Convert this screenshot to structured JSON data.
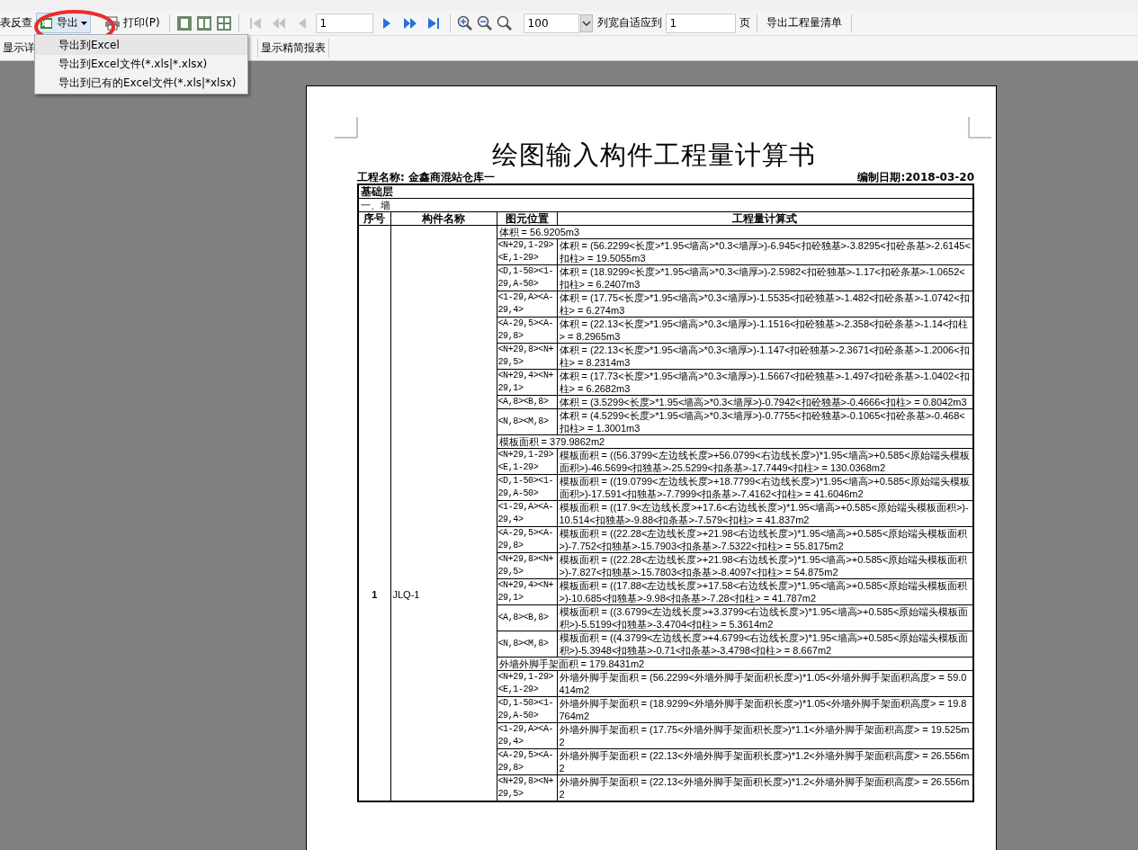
{
  "toolbar": {
    "reverse_lookup": "表反查",
    "export": "导出",
    "print": "打印(P)",
    "nav": [
      {
        "kind": "first",
        "disabled": true
      },
      {
        "kind": "prev",
        "disabled": true
      },
      {
        "kind": "step-back",
        "disabled": true
      }
    ],
    "page": "1",
    "nav_after": [
      {
        "kind": "step-forward",
        "disabled": false
      },
      {
        "kind": "next",
        "disabled": false
      },
      {
        "kind": "last",
        "disabled": false
      }
    ],
    "zoom": "100",
    "fit_label": "列宽自适应到",
    "fit_value": "1",
    "fit_unit": "页",
    "export_list": "导出工程量清单"
  },
  "toolbar2": {
    "detail": "显示详",
    "simple": "显示精简报表"
  },
  "export_menu": [
    {
      "label": "导出到Excel",
      "selected": true
    },
    {
      "label": "导出到Excel文件(*.xls|*.xlsx)",
      "selected": false
    },
    {
      "label": "导出到已有的Excel文件(*.xls|*xlsx)",
      "selected": false
    }
  ],
  "report": {
    "title": "绘图输入构件工程量计算书",
    "project": "工程名称: 金鑫商混站仓库一",
    "date": "编制日期:2018-03-20",
    "floor": "基础层",
    "section": "一、墙",
    "columns": [
      "序号",
      "构件名称",
      "图元位置",
      "工程量计算式"
    ],
    "items": [
      {
        "index": "1",
        "name": "JLQ-1",
        "groups": [
          {
            "summary": "体积 = 56.9205m3",
            "rows": [
              {
                "position": "<N+29,1-29><E,1-29>",
                "formula": "体积 = (56.2299<长度>*1.95<墙高>*0.3<墙厚>)-6.945<扣砼独基>-3.8295<扣砼条基>-2.6145<扣柱> = 19.5055m3"
              },
              {
                "position": "<D,1-50><1-29,A-50>",
                "formula": "体积 = (18.9299<长度>*1.95<墙高>*0.3<墙厚>)-2.5982<扣砼独基>-1.17<扣砼条基>-1.0652<扣柱> = 6.2407m3"
              },
              {
                "position": "<1-29,A><A-29,4>",
                "formula": "体积 = (17.75<长度>*1.95<墙高>*0.3<墙厚>)-1.5535<扣砼独基>-1.482<扣砼条基>-1.0742<扣柱> = 6.274m3"
              },
              {
                "position": "<A-29,5><A-29,8>",
                "formula": "体积 = (22.13<长度>*1.95<墙高>*0.3<墙厚>)-1.1516<扣砼独基>-2.358<扣砼条基>-1.14<扣柱> = 8.2965m3"
              },
              {
                "position": "<N+29,8><N+29,5>",
                "formula": "体积 = (22.13<长度>*1.95<墙高>*0.3<墙厚>)-1.147<扣砼独基>-2.3671<扣砼条基>-1.2006<扣柱> = 8.2314m3"
              },
              {
                "position": "<N+29,4><N+29,1>",
                "formula": "体积 = (17.73<长度>*1.95<墙高>*0.3<墙厚>)-1.5667<扣砼独基>-1.497<扣砼条基>-1.0402<扣柱> = 6.2682m3"
              },
              {
                "position": "<A,8><B,8>",
                "formula": "体积 = (3.5299<长度>*1.95<墙高>*0.3<墙厚>)-0.7942<扣砼独基>-0.4666<扣柱> = 0.8042m3"
              },
              {
                "position": "<N,8><M,8>",
                "formula": "体积 = (4.5299<长度>*1.95<墙高>*0.3<墙厚>)-0.7755<扣砼独基>-0.1065<扣砼条基>-0.468<扣柱> = 1.3001m3"
              }
            ]
          },
          {
            "summary": "模板面积 = 379.9862m2",
            "rows": [
              {
                "position": "<N+29,1-29><E,1-29>",
                "formula": "模板面积 = ((56.3799<左边线长度>+56.0799<右边线长度>)*1.95<墙高>+0.585<原始端头模板面积>)-46.5699<扣独基>-25.5299<扣条基>-17.7449<扣柱> = 130.0368m2"
              },
              {
                "position": "<D,1-50><1-29,A-50>",
                "formula": "模板面积 = ((19.0799<左边线长度>+18.7799<右边线长度>)*1.95<墙高>+0.585<原始端头模板面积>)-17.591<扣独基>-7.7999<扣条基>-7.4162<扣柱> = 41.6046m2"
              },
              {
                "position": "<1-29,A><A-29,4>",
                "formula": "模板面积 = ((17.9<左边线长度>+17.6<右边线长度>)*1.95<墙高>+0.585<原始端头模板面积>)-10.514<扣独基>-9.88<扣条基>-7.579<扣柱> = 41.837m2"
              },
              {
                "position": "<A-29,5><A-29,8>",
                "formula": "模板面积 = ((22.28<左边线长度>+21.98<右边线长度>)*1.95<墙高>+0.585<原始端头模板面积>)-7.752<扣独基>-15.7903<扣条基>-7.5322<扣柱> = 55.8175m2"
              },
              {
                "position": "<N+29,8><N+29,5>",
                "formula": "模板面积 = ((22.28<左边线长度>+21.98<右边线长度>)*1.95<墙高>+0.585<原始端头模板面积>)-7.827<扣独基>-15.7803<扣条基>-8.4097<扣柱> = 54.875m2"
              },
              {
                "position": "<N+29,4><N+29,1>",
                "formula": "模板面积 = ((17.88<左边线长度>+17.58<右边线长度>)*1.95<墙高>+0.585<原始端头模板面积>)-10.685<扣独基>-9.98<扣条基>-7.28<扣柱> = 41.787m2"
              },
              {
                "position": "<A,8><B,8>",
                "formula": "模板面积 = ((3.6799<左边线长度>+3.3799<右边线长度>)*1.95<墙高>+0.585<原始端头模板面积>)-5.5199<扣独基>-3.4704<扣柱> = 5.3614m2"
              },
              {
                "position": "<N,8><M,8>",
                "formula": "模板面积 = ((4.3799<左边线长度>+4.6799<右边线长度>)*1.95<墙高>+0.585<原始端头模板面积>)-5.3948<扣独基>-0.71<扣条基>-3.4798<扣柱> = 8.667m2"
              }
            ]
          },
          {
            "summary": "外墙外脚手架面积 = 179.8431m2",
            "rows": [
              {
                "position": "<N+29,1-29><E,1-29>",
                "formula": "外墙外脚手架面积 = (56.2299<外墙外脚手架面积长度>)*1.05<外墙外脚手架面积高度> = 59.0414m2"
              },
              {
                "position": "<D,1-50><1-29,A-50>",
                "formula": "外墙外脚手架面积 = (18.9299<外墙外脚手架面积长度>)*1.05<外墙外脚手架面积高度> = 19.8764m2"
              },
              {
                "position": "<1-29,A><A-29,4>",
                "formula": "外墙外脚手架面积 = (17.75<外墙外脚手架面积长度>)*1.1<外墙外脚手架面积高度> = 19.525m2"
              },
              {
                "position": "<A-29,5><A-29,8>",
                "formula": "外墙外脚手架面积 = (22.13<外墙外脚手架面积长度>)*1.2<外墙外脚手架面积高度> = 26.556m2"
              },
              {
                "position": "<N+29,8><N+29,5>",
                "formula": "外墙外脚手架面积 = (22.13<外墙外脚手架面积长度>)*1.2<外墙外脚手架面积高度> = 26.556m2"
              }
            ]
          }
        ]
      }
    ]
  }
}
